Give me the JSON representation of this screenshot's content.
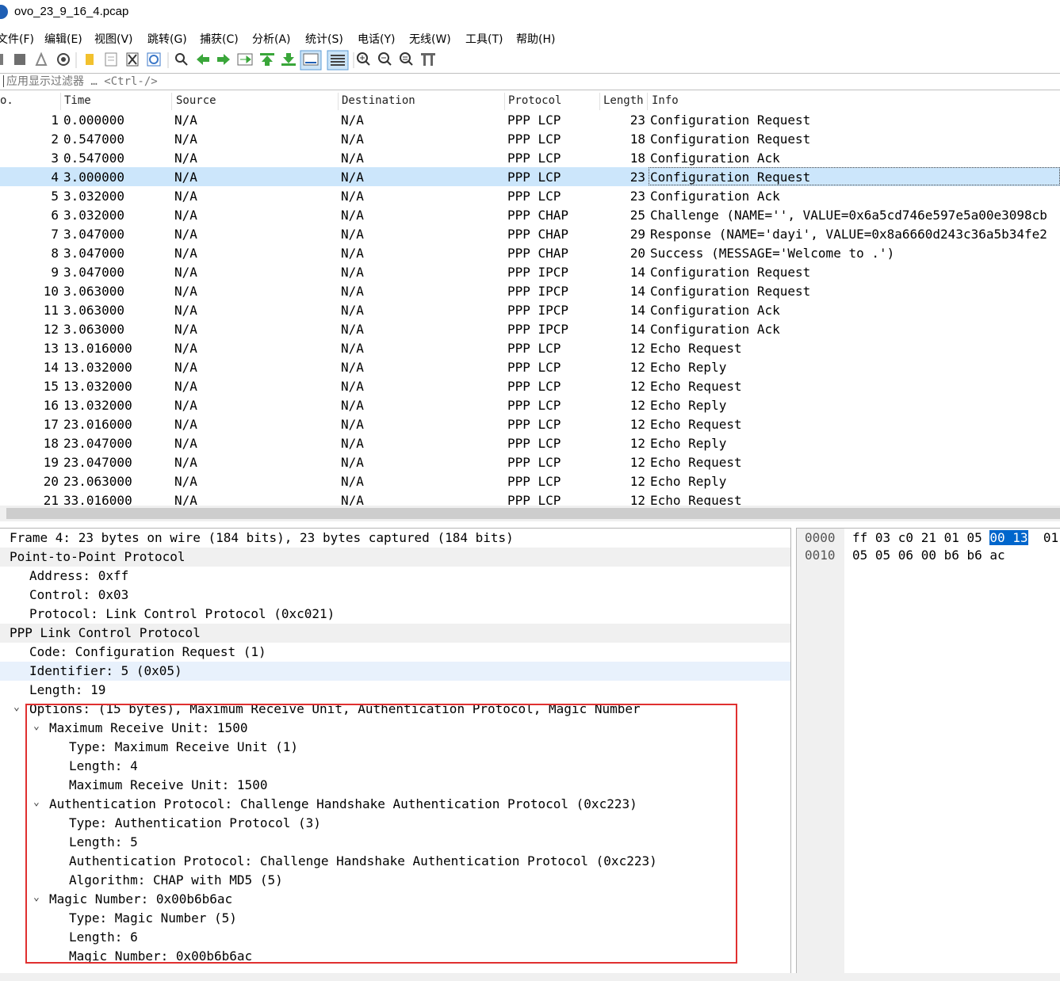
{
  "window": {
    "title": "ovo_23_9_16_4.pcap"
  },
  "menu": [
    "文件(F)",
    "编辑(E)",
    "视图(V)",
    "跳转(G)",
    "捕获(C)",
    "分析(A)",
    "统计(S)",
    "电话(Y)",
    "无线(W)",
    "工具(T)",
    "帮助(H)"
  ],
  "toolbar_icons": [
    "start-capture-icon",
    "stop-capture-icon",
    "restart-capture-icon",
    "capture-options-icon",
    "open-file-icon",
    "save-file-icon",
    "close-file-icon",
    "reload-file-icon",
    "find-packet-icon",
    "go-back-icon",
    "go-forward-icon",
    "go-to-packet-icon",
    "go-first-icon",
    "go-last-icon",
    "auto-scroll-icon",
    "colorize-icon",
    "zoom-in-icon",
    "zoom-out-icon",
    "normal-size-icon",
    "resize-columns-icon"
  ],
  "filter": {
    "placeholder": "应用显示过滤器 … <Ctrl-/>"
  },
  "packet_list": {
    "columns": [
      "o.",
      "Time",
      "Source",
      "Destination",
      "Protocol",
      "Length",
      "Info"
    ],
    "selected_index": 3,
    "rows": [
      {
        "no": "1",
        "time": "0.000000",
        "src": "N/A",
        "dst": "N/A",
        "proto": "PPP LCP",
        "len": "23",
        "info": "Configuration Request"
      },
      {
        "no": "2",
        "time": "0.547000",
        "src": "N/A",
        "dst": "N/A",
        "proto": "PPP LCP",
        "len": "18",
        "info": "Configuration Request"
      },
      {
        "no": "3",
        "time": "0.547000",
        "src": "N/A",
        "dst": "N/A",
        "proto": "PPP LCP",
        "len": "18",
        "info": "Configuration Ack"
      },
      {
        "no": "4",
        "time": "3.000000",
        "src": "N/A",
        "dst": "N/A",
        "proto": "PPP LCP",
        "len": "23",
        "info": "Configuration Request"
      },
      {
        "no": "5",
        "time": "3.032000",
        "src": "N/A",
        "dst": "N/A",
        "proto": "PPP LCP",
        "len": "23",
        "info": "Configuration Ack"
      },
      {
        "no": "6",
        "time": "3.032000",
        "src": "N/A",
        "dst": "N/A",
        "proto": "PPP CHAP",
        "len": "25",
        "info": "Challenge (NAME='', VALUE=0x6a5cd746e597e5a00e3098cb"
      },
      {
        "no": "7",
        "time": "3.047000",
        "src": "N/A",
        "dst": "N/A",
        "proto": "PPP CHAP",
        "len": "29",
        "info": "Response (NAME='dayi', VALUE=0x8a6660d243c36a5b34fe2"
      },
      {
        "no": "8",
        "time": "3.047000",
        "src": "N/A",
        "dst": "N/A",
        "proto": "PPP CHAP",
        "len": "20",
        "info": "Success (MESSAGE='Welcome to .')"
      },
      {
        "no": "9",
        "time": "3.047000",
        "src": "N/A",
        "dst": "N/A",
        "proto": "PPP IPCP",
        "len": "14",
        "info": "Configuration Request"
      },
      {
        "no": "10",
        "time": "3.063000",
        "src": "N/A",
        "dst": "N/A",
        "proto": "PPP IPCP",
        "len": "14",
        "info": "Configuration Request"
      },
      {
        "no": "11",
        "time": "3.063000",
        "src": "N/A",
        "dst": "N/A",
        "proto": "PPP IPCP",
        "len": "14",
        "info": "Configuration Ack"
      },
      {
        "no": "12",
        "time": "3.063000",
        "src": "N/A",
        "dst": "N/A",
        "proto": "PPP IPCP",
        "len": "14",
        "info": "Configuration Ack"
      },
      {
        "no": "13",
        "time": "13.016000",
        "src": "N/A",
        "dst": "N/A",
        "proto": "PPP LCP",
        "len": "12",
        "info": "Echo Request"
      },
      {
        "no": "14",
        "time": "13.032000",
        "src": "N/A",
        "dst": "N/A",
        "proto": "PPP LCP",
        "len": "12",
        "info": "Echo Reply"
      },
      {
        "no": "15",
        "time": "13.032000",
        "src": "N/A",
        "dst": "N/A",
        "proto": "PPP LCP",
        "len": "12",
        "info": "Echo Request"
      },
      {
        "no": "16",
        "time": "13.032000",
        "src": "N/A",
        "dst": "N/A",
        "proto": "PPP LCP",
        "len": "12",
        "info": "Echo Reply"
      },
      {
        "no": "17",
        "time": "23.016000",
        "src": "N/A",
        "dst": "N/A",
        "proto": "PPP LCP",
        "len": "12",
        "info": "Echo Request"
      },
      {
        "no": "18",
        "time": "23.047000",
        "src": "N/A",
        "dst": "N/A",
        "proto": "PPP LCP",
        "len": "12",
        "info": "Echo Reply"
      },
      {
        "no": "19",
        "time": "23.047000",
        "src": "N/A",
        "dst": "N/A",
        "proto": "PPP LCP",
        "len": "12",
        "info": "Echo Request"
      },
      {
        "no": "20",
        "time": "23.063000",
        "src": "N/A",
        "dst": "N/A",
        "proto": "PPP LCP",
        "len": "12",
        "info": "Echo Reply"
      },
      {
        "no": "21",
        "time": "33.016000",
        "src": "N/A",
        "dst": "N/A",
        "proto": "PPP LCP",
        "len": "12",
        "info": "Echo Request"
      }
    ]
  },
  "details": [
    {
      "text": "Frame 4: 23 bytes on wire (184 bits), 23 bytes captured (184 bits)",
      "level": 0,
      "style": "plain",
      "chevron": "closed"
    },
    {
      "text": "Point-to-Point Protocol",
      "level": 0,
      "style": "grey",
      "chevron": "closed"
    },
    {
      "text": "Address: 0xff",
      "level": 1,
      "style": "plain",
      "chevron": ""
    },
    {
      "text": "Control: 0x03",
      "level": 1,
      "style": "plain",
      "chevron": ""
    },
    {
      "text": "Protocol: Link Control Protocol (0xc021)",
      "level": 1,
      "style": "plain",
      "chevron": ""
    },
    {
      "text": "PPP Link Control Protocol",
      "level": 0,
      "style": "grey",
      "chevron": "closed"
    },
    {
      "text": "Code: Configuration Request (1)",
      "level": 1,
      "style": "plain",
      "chevron": ""
    },
    {
      "text": "Identifier: 5 (0x05)",
      "level": 1,
      "style": "sel",
      "chevron": ""
    },
    {
      "text": "Length: 19",
      "level": 1,
      "style": "plain",
      "chevron": ""
    },
    {
      "text": "Options: (15 bytes), Maximum Receive Unit, Authentication Protocol, Magic Number",
      "level": 1,
      "style": "plain",
      "chevron": "open"
    },
    {
      "text": "Maximum Receive Unit: 1500",
      "level": 2,
      "style": "plain",
      "chevron": "open"
    },
    {
      "text": "Type: Maximum Receive Unit (1)",
      "level": 3,
      "style": "plain",
      "chevron": ""
    },
    {
      "text": "Length: 4",
      "level": 3,
      "style": "plain",
      "chevron": ""
    },
    {
      "text": "Maximum Receive Unit: 1500",
      "level": 3,
      "style": "plain",
      "chevron": ""
    },
    {
      "text": "Authentication Protocol: Challenge Handshake Authentication Protocol (0xc223)",
      "level": 2,
      "style": "plain",
      "chevron": "open"
    },
    {
      "text": "Type: Authentication Protocol (3)",
      "level": 3,
      "style": "plain",
      "chevron": ""
    },
    {
      "text": "Length: 5",
      "level": 3,
      "style": "plain",
      "chevron": ""
    },
    {
      "text": "Authentication Protocol: Challenge Handshake Authentication Protocol (0xc223)",
      "level": 3,
      "style": "plain",
      "chevron": ""
    },
    {
      "text": "Algorithm: CHAP with MD5 (5)",
      "level": 3,
      "style": "plain",
      "chevron": ""
    },
    {
      "text": "Magic Number: 0x00b6b6ac",
      "level": 2,
      "style": "plain",
      "chevron": "open"
    },
    {
      "text": "Type: Magic Number (5)",
      "level": 3,
      "style": "plain",
      "chevron": ""
    },
    {
      "text": "Length: 6",
      "level": 3,
      "style": "plain",
      "chevron": ""
    },
    {
      "text": "Magic Number: 0x00b6b6ac",
      "level": 3,
      "style": "plain",
      "chevron": ""
    }
  ],
  "bytes": [
    {
      "offset": "0000",
      "pre": "ff 03 c0 21 01 05 ",
      "hl": "00 13",
      "post": "  01"
    },
    {
      "offset": "0010",
      "pre": "05 05 06 00 b6 b6 ac",
      "hl": "",
      "post": ""
    }
  ],
  "colors": {
    "selected_row": "#cce6fb",
    "highlight_box": "#e03030",
    "bytes_highlight": "#0066cc"
  }
}
